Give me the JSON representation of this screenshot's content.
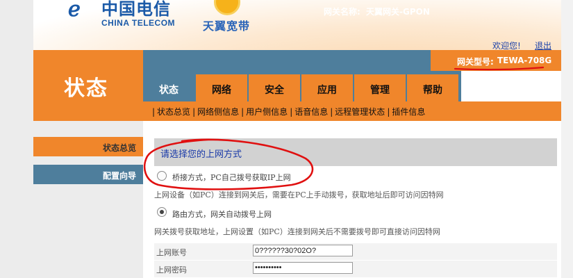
{
  "header": {
    "logo_mark": "ℯ",
    "logo_cn": "中国电信",
    "logo_en": "CHINA TELECOM",
    "brand_cn": "天翼宽带",
    "welcome": "欢迎您!",
    "logout": "退出"
  },
  "title": "状态",
  "gateway": {
    "name_label": "网关名称:",
    "name_value": "天翼网关-GPON",
    "model_label": "网关型号:",
    "model_value": "TEWA-708G"
  },
  "tabs": [
    {
      "label": "状态"
    },
    {
      "label": "网络"
    },
    {
      "label": "安全"
    },
    {
      "label": "应用"
    },
    {
      "label": "管理"
    },
    {
      "label": "帮助"
    }
  ],
  "subnav": [
    {
      "label": "状态总览"
    },
    {
      "label": "网络侧信息"
    },
    {
      "label": "用户侧信息"
    },
    {
      "label": "语音信息"
    },
    {
      "label": "远程管理状态"
    },
    {
      "label": "插件信息"
    }
  ],
  "sidebar": {
    "items": [
      {
        "label": "状态总览"
      },
      {
        "label": "配置向导"
      }
    ]
  },
  "main": {
    "section_title": "请选择您的上网方式",
    "bridge_option": "桥接方式，PC自己拨号获取IP上网",
    "bridge_desc": "上网设备（如PC）连接到网关后，需要在PC上手动拨号，获取地址后即可访问因特网",
    "route_option": "路由方式，网关自动拨号上网",
    "route_desc": "网关拨号获取地址，上网设置（如PC）连接到网关后不需要拨号即可直接访问因特网",
    "selected_mode": "route",
    "account_label": "上网账号",
    "account_value": "0??????30?02O?",
    "password_label": "上网密码",
    "password_value": "••••••••••"
  },
  "colors": {
    "orange": "#f0862b",
    "steel_blue": "#4e7e9c",
    "annotation_red": "#e01010"
  }
}
